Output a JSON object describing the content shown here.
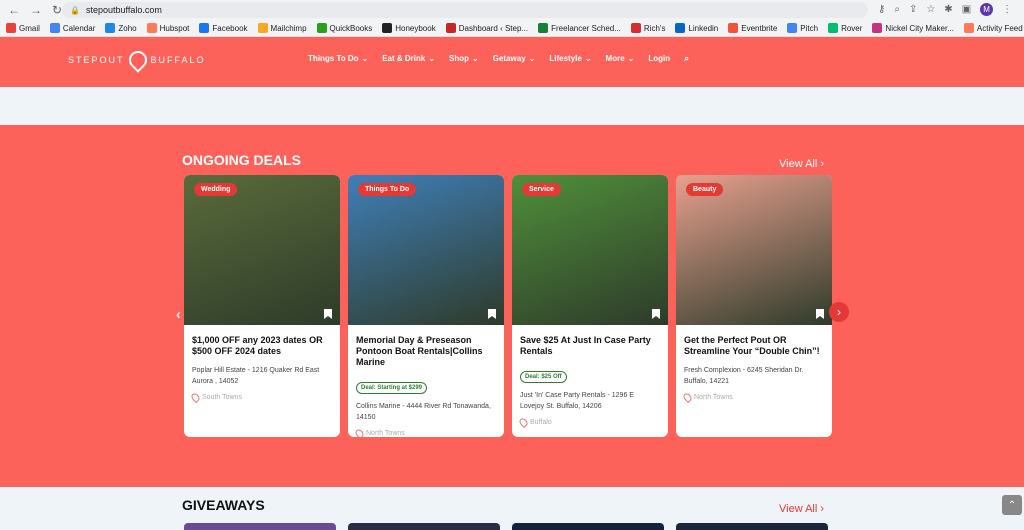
{
  "browser": {
    "url": "stepoutbuffalo.com",
    "avatar_letter": "M",
    "bookmarks": [
      {
        "label": "Gmail",
        "color": "#ea4335"
      },
      {
        "label": "Calendar",
        "color": "#4285f4"
      },
      {
        "label": "Zoho",
        "color": "#1e88e5"
      },
      {
        "label": "Hubspot",
        "color": "#ff7a59"
      },
      {
        "label": "Facebook",
        "color": "#1877f2"
      },
      {
        "label": "Mailchimp",
        "color": "#f9a825"
      },
      {
        "label": "QuickBooks",
        "color": "#2ca01c"
      },
      {
        "label": "Honeybook",
        "color": "#222222"
      },
      {
        "label": "Dashboard ‹ Step...",
        "color": "#c62828"
      },
      {
        "label": "Freelancer Sched...",
        "color": "#188038"
      },
      {
        "label": "Rich's",
        "color": "#d32f2f"
      },
      {
        "label": "Linkedin",
        "color": "#0a66c2"
      },
      {
        "label": "Eventbrite",
        "color": "#f05537"
      },
      {
        "label": "Pitch",
        "color": "#4285f4"
      },
      {
        "label": "Rover",
        "color": "#00bd70"
      },
      {
        "label": "Nickel City Maker...",
        "color": "#c13584"
      },
      {
        "label": "Activity Feed",
        "color": "#ff7a59"
      }
    ]
  },
  "site": {
    "logo_left": "STEPOUT",
    "logo_right": "BUFFALO",
    "nav": [
      {
        "label": "Things To Do"
      },
      {
        "label": "Eat & Drink"
      },
      {
        "label": "Shop"
      },
      {
        "label": "Getaway"
      },
      {
        "label": "Lifestyle"
      },
      {
        "label": "More"
      }
    ],
    "login": "Login"
  },
  "deals": {
    "title": "ONGOING DEALS",
    "view_all": "View All",
    "cards": [
      {
        "tag": "Wedding",
        "title": "$1,000 OFF any 2023 dates OR $500 OFF 2024 dates",
        "deal": "",
        "address": "Poplar Hill Estate - 1216 Quaker Rd East Aurora , 14052",
        "location": "South Towns",
        "img_color": "#5a6b3a"
      },
      {
        "tag": "Things To Do",
        "title": "Memorial Day & Preseason Pontoon Boat Rentals|Collins Marine",
        "deal": "Deal: Starting at $299",
        "address": "Collins Marine - 4444 River Rd Tonawanda, 14150",
        "location": "North Towns",
        "img_color": "#3f7fb8"
      },
      {
        "tag": "Service",
        "title": "Save $25 At Just In Case Party Rentals",
        "deal": "Deal: $25 Off",
        "address": "Just 'In' Case Party Rentals - 1296 E Lovejoy St. Buffalo, 14206",
        "location": "Buffalo",
        "img_color": "#4f8f3a"
      },
      {
        "tag": "Beauty",
        "title": "Get the Perfect Pout OR Streamline Your “Double Chin”!",
        "deal": "",
        "address": "Fresh Complexion - 6245 Sheridan Dr. Buffalo, 14221",
        "location": "North Towns",
        "img_color": "#e8a08e"
      }
    ]
  },
  "giveaways": {
    "title": "GIVEAWAYS",
    "view_all": "View All"
  }
}
